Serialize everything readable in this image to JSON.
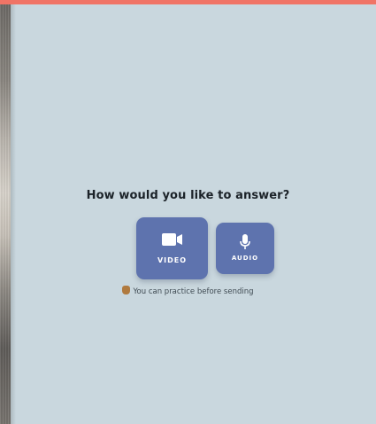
{
  "question": "How would you like to answer?",
  "options": [
    {
      "label": "VIDEO",
      "icon": "video-camera-icon"
    },
    {
      "label": "AUDIO",
      "icon": "microphone-icon"
    }
  ],
  "hint": {
    "icon": "hand-icon",
    "text": "You can practice before sending"
  },
  "colors": {
    "accent_bar": "#f07466",
    "background": "#c9d7de",
    "button": "#5e73ae"
  }
}
